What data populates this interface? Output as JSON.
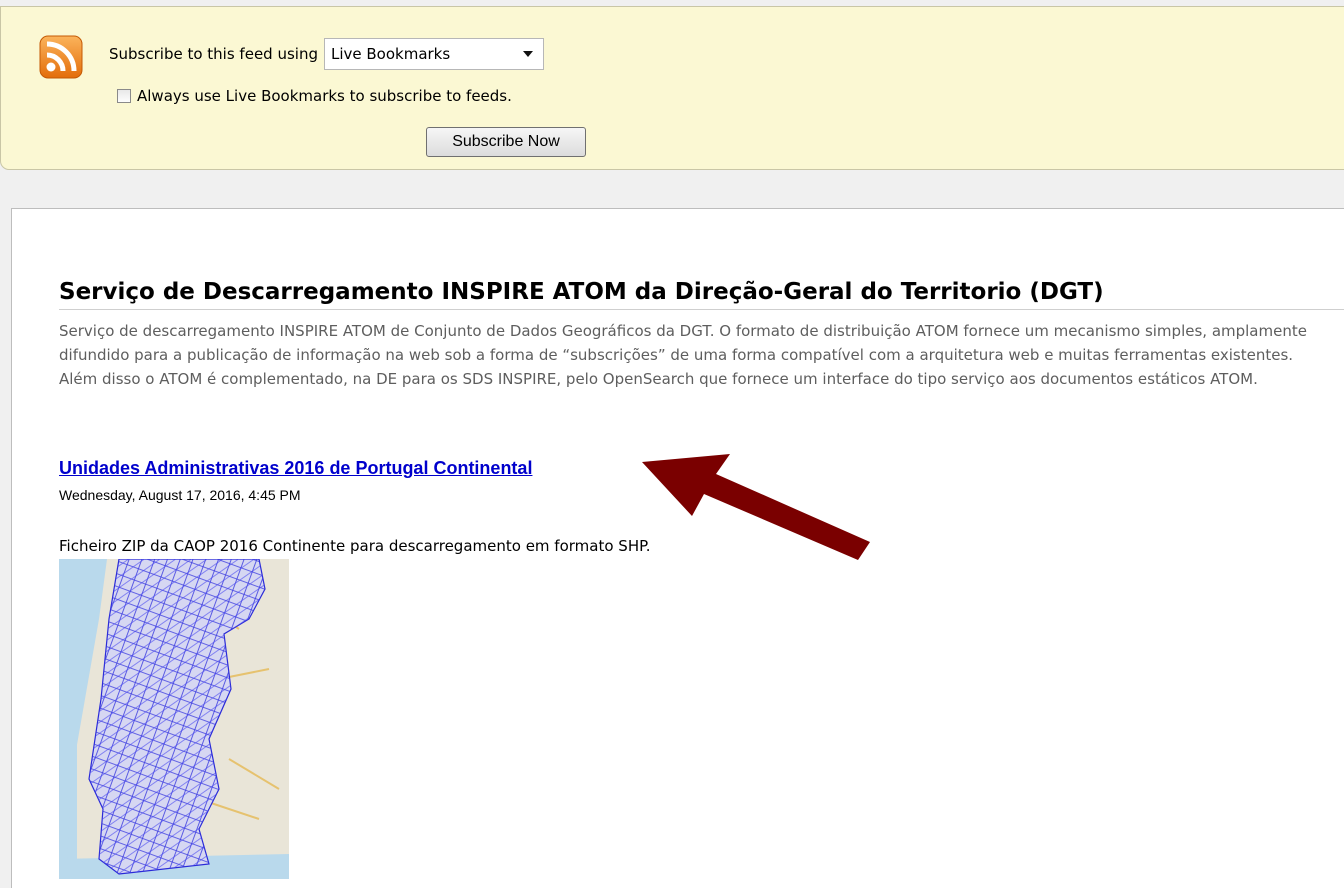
{
  "subscribe_panel": {
    "label": "Subscribe to this feed using",
    "reader_selected": "Live Bookmarks",
    "always_use_label": "Always use Live Bookmarks to subscribe to feeds.",
    "always_use_checked": false,
    "subscribe_button": "Subscribe Now"
  },
  "feed": {
    "title": "Serviço de Descarregamento INSPIRE ATOM da Direção-Geral do Territorio (DGT)",
    "subtitle": "Serviço de descarregamento INSPIRE ATOM de Conjunto de Dados Geográficos da DGT. O formato de distribuição ATOM fornece um mecanismo simples, amplamente difundido para a publicação de informação na web sob a forma de “subscrições” de uma forma compatível com a arquitetura web e muitas ferramentas existentes. Além disso o ATOM é complementado, na DE para os SDS INSPIRE, pelo OpenSearch que fornece um interface do tipo serviço aos documentos estáticos ATOM."
  },
  "entry": {
    "title": "Unidades Administrativas 2016 de Portugal Continental",
    "date": "Wednesday, August 17, 2016, 4:45 PM",
    "description": "Ficheiro ZIP da CAOP 2016 Continente para descarregamento em formato SHP."
  },
  "icons": {
    "feed": "rss-feed-icon",
    "annotation": "red-arrow-annotation"
  },
  "colors": {
    "panel_background": "#fbf8d3",
    "link": "#0000cc",
    "rss_orange": "#f28a1e",
    "arrow": "#7a0000"
  }
}
